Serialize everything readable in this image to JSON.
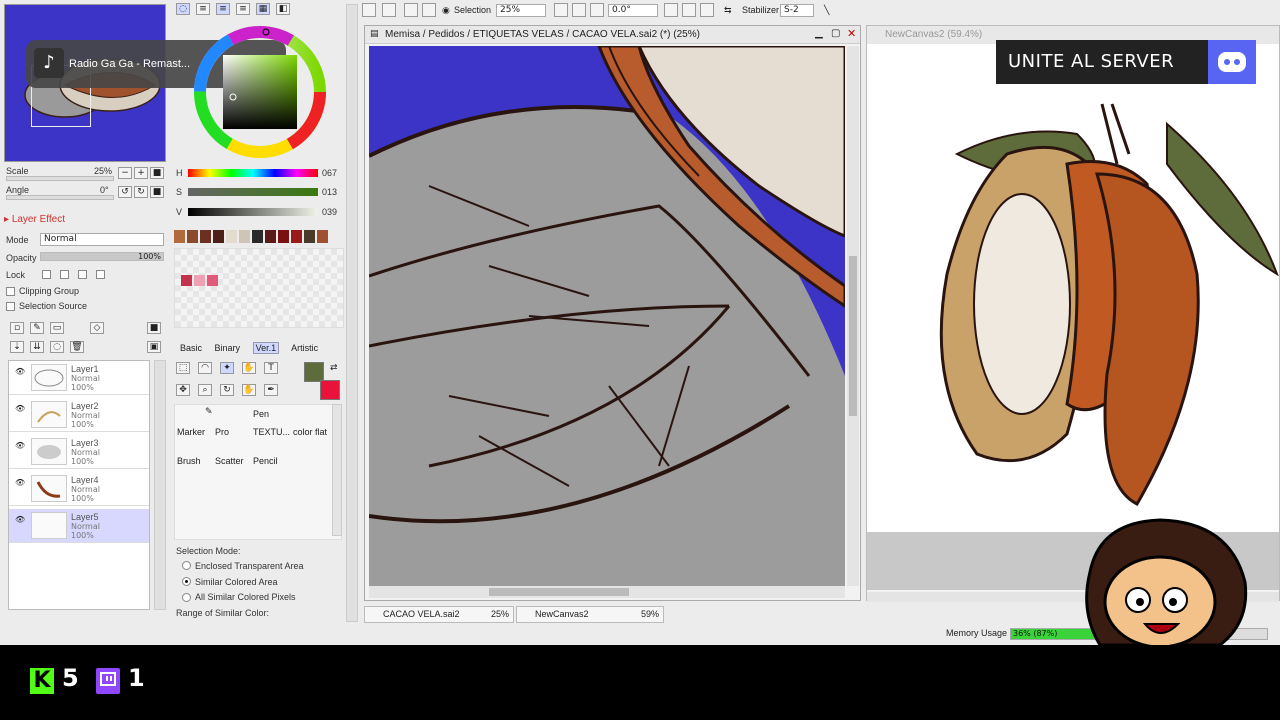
{
  "navigator": {
    "scale_label": "Scale",
    "scale_value": "25%",
    "angle_label": "Angle",
    "angle_value": "0°"
  },
  "now_playing": {
    "title": "Radio Ga Ga - Remast..."
  },
  "layer_effect": {
    "header": "Layer Effect",
    "mode_label": "Mode",
    "mode_value": "Normal",
    "opacity_label": "Opacity",
    "opacity_value": "100%",
    "lock_label": "Lock",
    "clipping_group": "Clipping Group",
    "selection_source": "Selection Source"
  },
  "layers": [
    {
      "name": "Layer1",
      "mode": "Normal",
      "opacity": "100%"
    },
    {
      "name": "Layer2",
      "mode": "Normal",
      "opacity": "100%"
    },
    {
      "name": "Layer3",
      "mode": "Normal",
      "opacity": "100%"
    },
    {
      "name": "Layer4",
      "mode": "Normal",
      "opacity": "100%"
    },
    {
      "name": "Layer5",
      "mode": "Normal",
      "opacity": "100%"
    }
  ],
  "color": {
    "h_label": "H",
    "h_value": "067",
    "s_label": "S",
    "s_value": "013",
    "v_label": "V",
    "v_value": "039",
    "primary": "#5e6b3a",
    "secondary": "#e8123a"
  },
  "palette": [
    "#b06a3b",
    "#8a4a2b",
    "#6b3020",
    "#4a2018",
    "#e3dbd0",
    "#cfc5b6",
    "#2a2a2a",
    "#5a1a1a",
    "#7a1010",
    "#9a1a1a",
    "#4a3a2a",
    "#a05030"
  ],
  "swatches": [
    "#c2334e",
    "#f0a0b4",
    "#e05a7a"
  ],
  "tool_tabs": [
    "Basic",
    "Binary",
    "Ver.1",
    "Artistic"
  ],
  "brush_tools": [
    {
      "label": "Pen"
    },
    {
      "label": "Marker"
    },
    {
      "label": "Pro"
    },
    {
      "label": "TEXTU..."
    },
    {
      "label": "color flat"
    },
    {
      "label": "Brush"
    },
    {
      "label": "Scatter"
    },
    {
      "label": "Pencil"
    }
  ],
  "selection_mode": {
    "label": "Selection Mode:",
    "options": [
      "Enclosed Transparent Area",
      "Similar Colored Area",
      "All Similar Colored Pixels"
    ],
    "selected": 1,
    "range_label": "Range of Similar Color:"
  },
  "toolbar": {
    "selection_label": "Selection",
    "zoom_value": "25%",
    "angle_value": "0.0°",
    "stabilizer_label": "Stabilizer",
    "stabilizer_value": "S-2"
  },
  "canvas1": {
    "title": "Memisa / Pedidos / ETIQUETAS VELAS / CACAO VELA.sai2 (*) (25%)"
  },
  "canvas2": {
    "title": "NewCanvas2 (59.4%)"
  },
  "doc_tabs": [
    {
      "name": "CACAO VELA.sai2",
      "zoom": "25%"
    },
    {
      "name": "NewCanvas2",
      "zoom": "59%"
    }
  ],
  "memory": {
    "label": "Memory Usage",
    "value": "36% (87%)",
    "fraction": 0.36
  },
  "overlay": {
    "banner_text": "UNITE AL SERVER",
    "kick_count": "5",
    "twitch_count": "1"
  }
}
